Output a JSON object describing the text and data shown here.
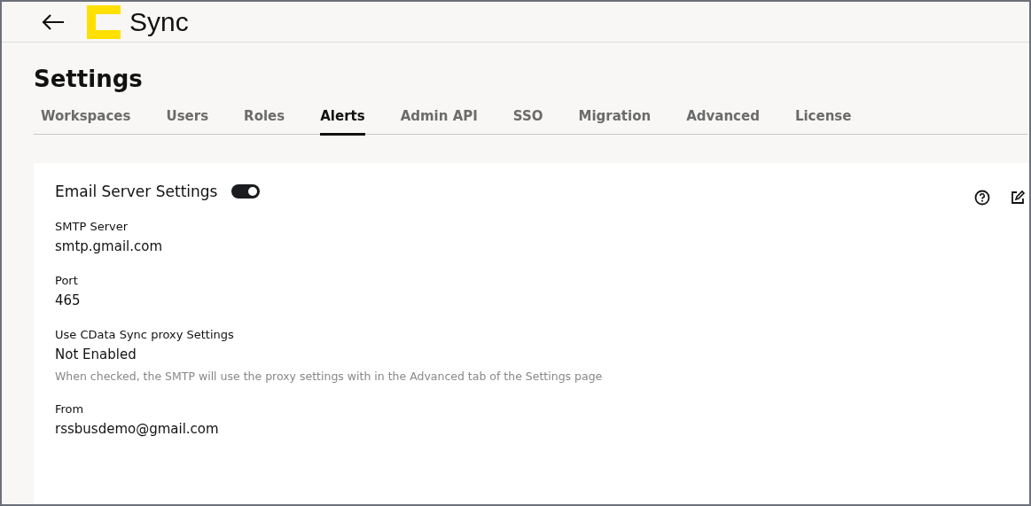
{
  "header": {
    "logo_text": "Sync"
  },
  "page_title": "Settings",
  "tabs": [
    {
      "label": "Workspaces",
      "selected": false
    },
    {
      "label": "Users",
      "selected": false
    },
    {
      "label": "Roles",
      "selected": false
    },
    {
      "label": "Alerts",
      "selected": true
    },
    {
      "label": "Admin API",
      "selected": false
    },
    {
      "label": "SSO",
      "selected": false
    },
    {
      "label": "Migration",
      "selected": false
    },
    {
      "label": "Advanced",
      "selected": false
    },
    {
      "label": "License",
      "selected": false
    }
  ],
  "card": {
    "title": "Email Server Settings",
    "enabled": true,
    "fields": [
      {
        "label": "SMTP Server",
        "value": "smtp.gmail.com"
      },
      {
        "label": "Port",
        "value": "465"
      },
      {
        "label": "Use CData Sync proxy Settings",
        "value": "Not Enabled",
        "hint": "When checked, the SMTP will use the proxy settings with in the Advanced tab of the Settings page"
      },
      {
        "label": "From",
        "value": "rssbusdemo@gmail.com"
      }
    ]
  }
}
